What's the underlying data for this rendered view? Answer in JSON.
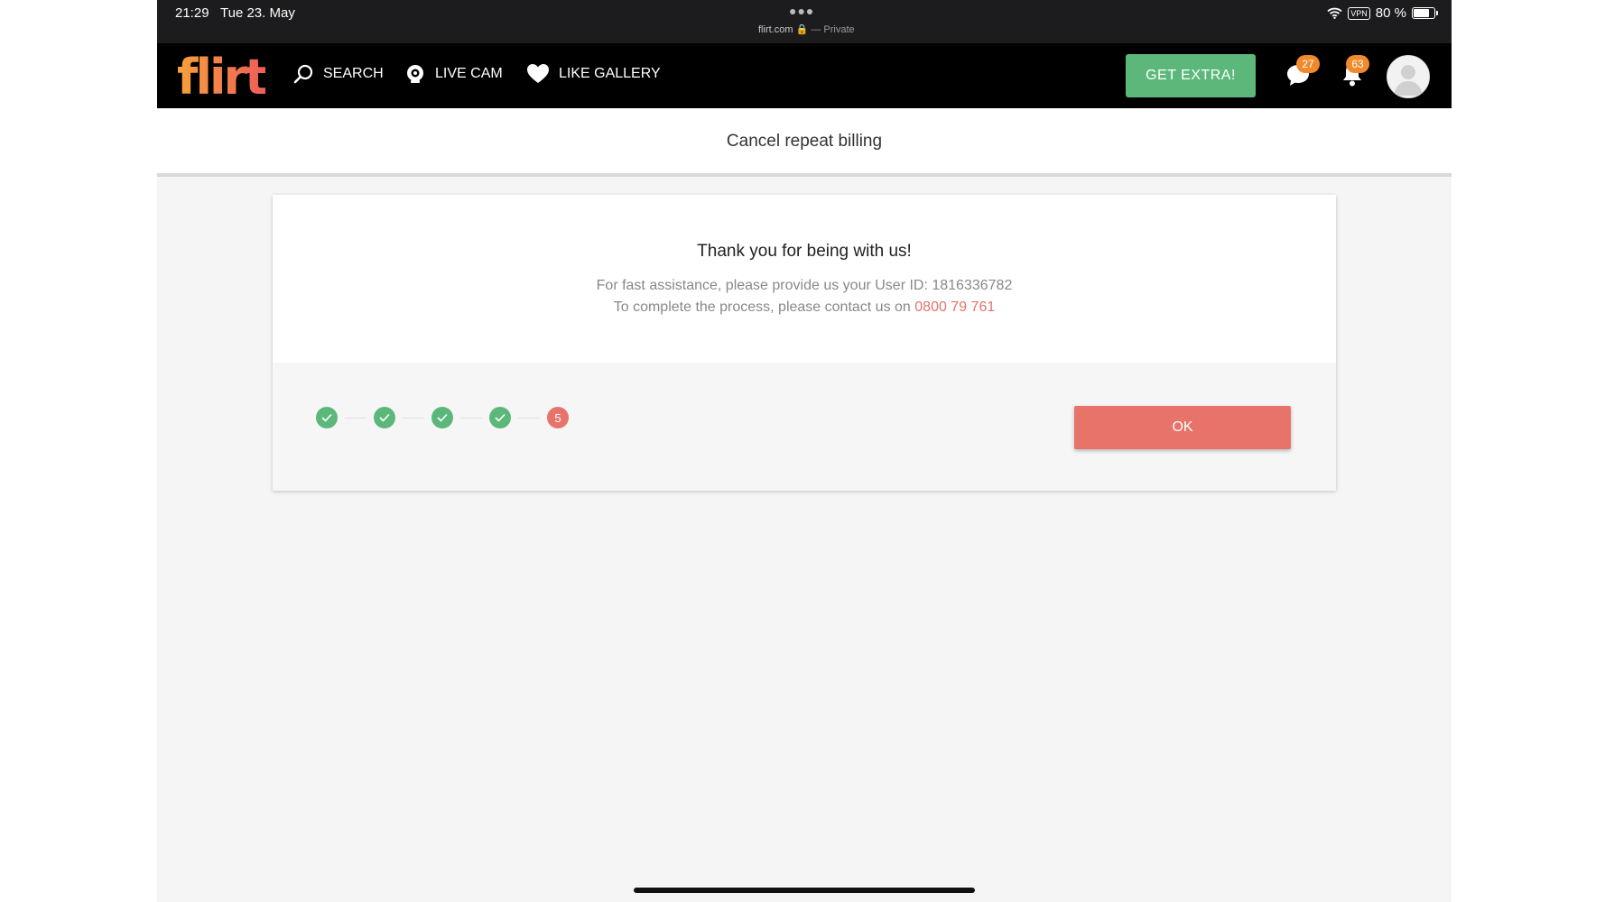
{
  "status_bar": {
    "time": "21:29",
    "date": "Tue 23. May",
    "url": "flirt.com",
    "privacy": "— Private",
    "vpn": "VPN",
    "battery": "80 %",
    "battery_level": 0.8
  },
  "nav": {
    "logo": "flirt",
    "items": [
      {
        "label": "SEARCH",
        "icon": "search-icon"
      },
      {
        "label": "LIVE CAM",
        "icon": "webcam-icon"
      },
      {
        "label": "LIKE GALLERY",
        "icon": "heart-icon"
      }
    ],
    "get_extra_label": "GET EXTRA!",
    "messages_count": "27",
    "notifications_count": "63"
  },
  "page": {
    "title": "Cancel repeat billing"
  },
  "card": {
    "heading": "Thank you for being with us!",
    "line1": "For fast assistance, please provide us your User ID: 1816336782",
    "line2_prefix": "To complete the process, please contact us on ",
    "phone": "0800 79 761",
    "current_step": "5",
    "ok_label": "OK"
  },
  "colors": {
    "accent_green": "#5cb87a",
    "accent_red": "#e8736b",
    "badge_orange": "#f08a2c",
    "nav_bg": "#000000"
  }
}
